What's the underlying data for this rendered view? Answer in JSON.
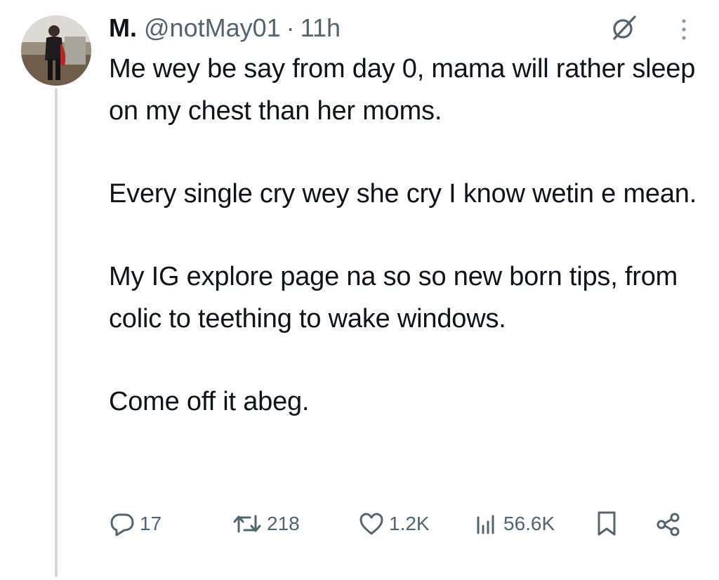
{
  "tweet": {
    "author": {
      "display_name": "M.",
      "handle": "@notMay01"
    },
    "separator": "·",
    "time": "11h",
    "paragraphs": [
      "Me wey be say from day 0, mama will rather sleep on my chest than her moms.",
      "Every single cry wey she cry I know wetin e mean.",
      "My IG explore page na so so new born tips, from colic to teething to wake windows.",
      "Come off it abeg."
    ]
  },
  "actions": {
    "replies": "17",
    "reposts": "218",
    "likes": "1.2K",
    "views": "56.6K"
  },
  "icons": {
    "header": [
      "grok-icon",
      "more-icon"
    ],
    "actions": [
      "reply-icon",
      "repost-icon",
      "like-icon",
      "views-icon",
      "bookmark-icon",
      "share-icon"
    ]
  },
  "colors": {
    "text": "#0f1419",
    "secondary": "#536471",
    "thread_line": "#cfd9de",
    "background": "#ffffff"
  }
}
